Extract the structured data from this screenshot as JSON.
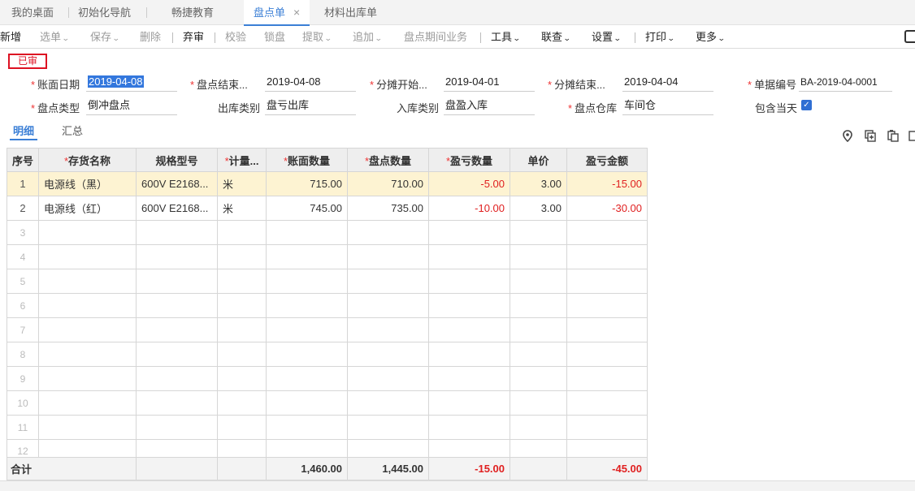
{
  "tabs": [
    {
      "label": "我的桌面"
    },
    {
      "label": "初始化导航"
    },
    {
      "label": "畅捷教育"
    },
    {
      "label": "盘点单",
      "close": "×"
    },
    {
      "label": "材料出库单"
    }
  ],
  "toolbar": {
    "new": "新增",
    "select_order": "选单",
    "save": "保存",
    "delete": "删除",
    "abandon_audit": "弃审",
    "verify": "校验",
    "lock": "锁盘",
    "extract": "提取",
    "append": "追加",
    "period_business": "盘点期间业务",
    "tools": "工具",
    "link_query": "联查",
    "settings": "设置",
    "print": "打印",
    "more": "更多"
  },
  "status_stamp": "已审",
  "form": {
    "book_date": {
      "label": "账面日期",
      "value": "2019-04-08"
    },
    "count_end": {
      "label": "盘点结束...",
      "value": "2019-04-08"
    },
    "alloc_start": {
      "label": "分摊开始...",
      "value": "2019-04-01"
    },
    "alloc_end": {
      "label": "分摊结束...",
      "value": "2019-04-04"
    },
    "doc_no": {
      "label": "单据编号",
      "value": "BA-2019-04-0001"
    },
    "count_type": {
      "label": "盘点类型",
      "value": "倒冲盘点"
    },
    "out_type": {
      "label": "出库类别",
      "value": "盘亏出库"
    },
    "in_type": {
      "label": "入库类别",
      "value": "盘盈入库"
    },
    "warehouse": {
      "label": "盘点仓库",
      "value": "车间仓"
    },
    "include_today": {
      "label": "包含当天",
      "checked": true
    }
  },
  "subtabs": {
    "detail": "明细",
    "summary": "汇总"
  },
  "grid": {
    "headers": {
      "seq": "序号",
      "name": "存货名称",
      "spec": "规格型号",
      "unit": "计量...",
      "book_qty": "账面数量",
      "count_qty": "盘点数量",
      "diff_qty": "盈亏数量",
      "price": "单价",
      "diff_amount": "盈亏金额"
    },
    "rows": [
      {
        "seq": "1",
        "name": "电源线（黑）",
        "spec": "600V E2168...",
        "unit": "米",
        "book_qty": "715.00",
        "count_qty": "710.00",
        "diff_qty": "-5.00",
        "price": "3.00",
        "diff_amount": "-15.00"
      },
      {
        "seq": "2",
        "name": "电源线（红）",
        "spec": "600V E2168...",
        "unit": "米",
        "book_qty": "745.00",
        "count_qty": "735.00",
        "diff_qty": "-10.00",
        "price": "3.00",
        "diff_amount": "-30.00"
      }
    ],
    "empty_rows": [
      "3",
      "4",
      "5",
      "6",
      "7",
      "8",
      "9",
      "10",
      "11",
      "12"
    ],
    "total": {
      "label": "合计",
      "book_qty": "1,460.00",
      "count_qty": "1,445.00",
      "diff_qty": "-15.00",
      "diff_amount": "-45.00"
    }
  },
  "icons": [
    "location-icon",
    "add-row-icon",
    "copy-row-icon",
    "more-icon",
    "camera-icon",
    "checkbox-checked-icon"
  ]
}
